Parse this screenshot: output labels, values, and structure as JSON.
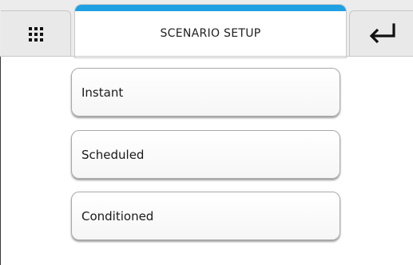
{
  "header": {
    "title": "SCENARIO SETUP",
    "menu_icon": "grid-menu-icon",
    "back_icon": "return-arrow-icon",
    "accent_color": "#1fa0e2"
  },
  "options": [
    {
      "label": "Instant"
    },
    {
      "label": "Scheduled"
    },
    {
      "label": "Conditioned"
    }
  ]
}
